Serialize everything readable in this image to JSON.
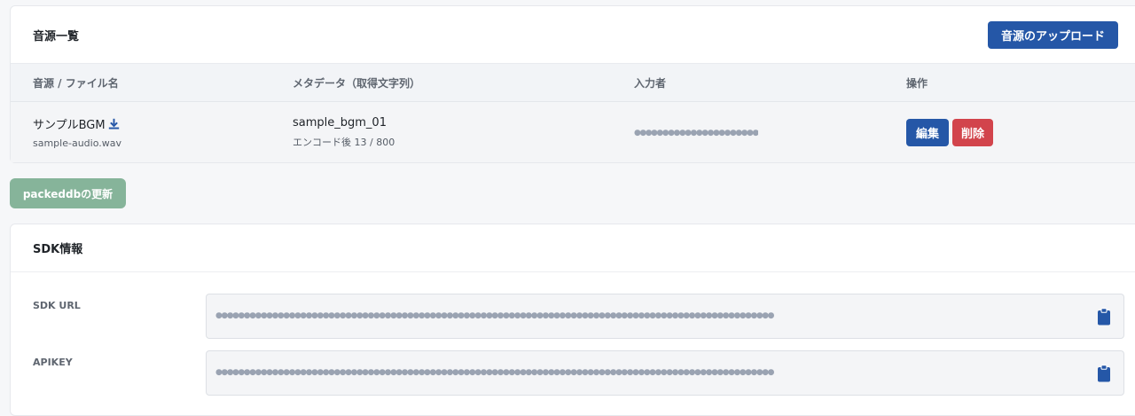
{
  "audio_list": {
    "title": "音源一覧",
    "upload_label": "音源のアップロード",
    "columns": [
      "音源 / ファイル名",
      "メタデータ（取得文字列）",
      "入力者",
      "操作"
    ],
    "rows": [
      {
        "name": "サンプルBGM",
        "file": "sample-audio.wav",
        "meta": "sample_bgm_01",
        "meta_sub": "エンコード後 13 / 800",
        "author_masked": "●●●●●●●●●●●●●●●●●●●●●●",
        "edit_label": "編集",
        "delete_label": "削除"
      }
    ]
  },
  "packed_label": "packeddbの更新",
  "sdk": {
    "title": "SDK情報",
    "url_label": "SDK URL",
    "url_value": "●●●●●●●●●●●●●●●●●●●●●●●●●●●●●●●●●●●●●●●●●●●●●●●●●●●●●●●●●●●●●●●●●●●●●●●●●●●●●●●●●●●●●●●●●●●●●●●●●●●",
    "apikey_label": "APIKEY",
    "apikey_value": "●●●●●●●●●●●●●●●●●●●●●●●●●●●●●●●●●●●●●●●●●●●●●●●●●●●●●●●●●●●●●●●●●●●●●●●●●●●●●●●●●●●●●●●●●●●●●●●●●●●"
  },
  "colors": {
    "primary": "#2557a7",
    "danger": "#d2444c",
    "packed": "#86b49a"
  }
}
